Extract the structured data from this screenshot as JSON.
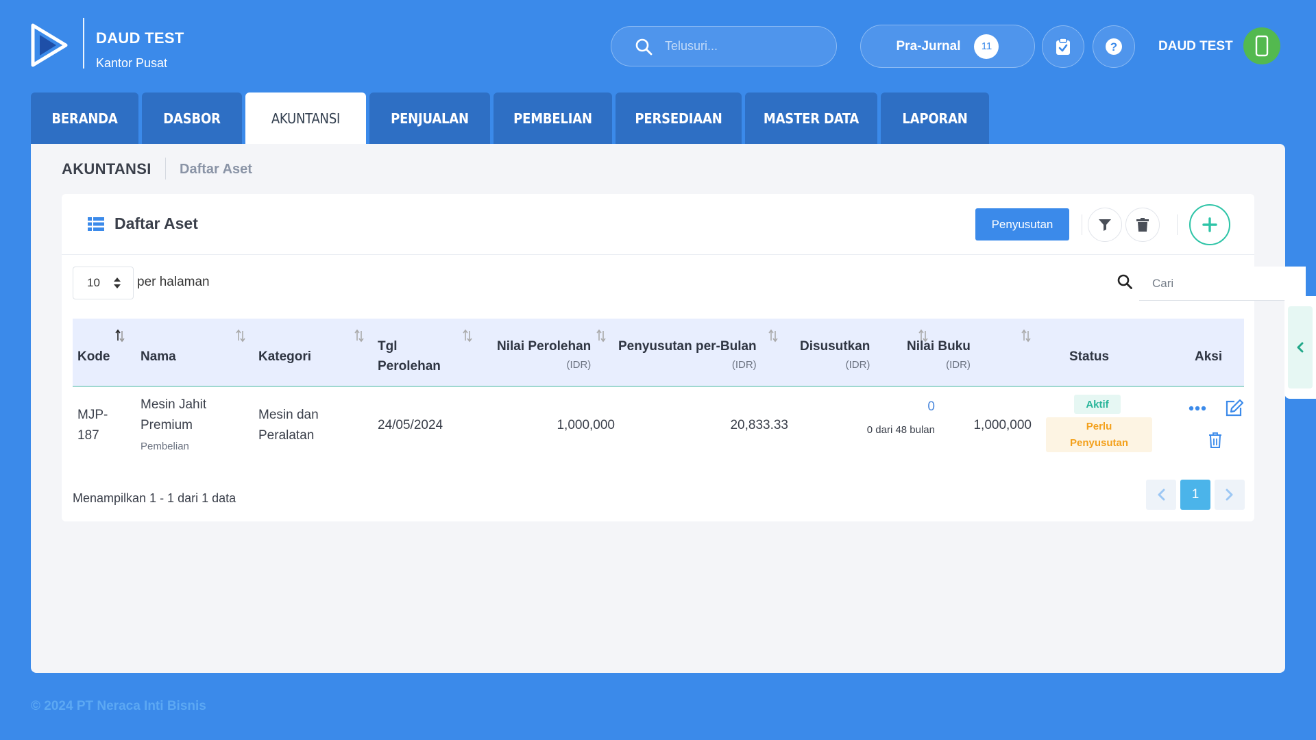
{
  "brand": {
    "name": "DAUD TEST",
    "subtitle": "Kantor Pusat"
  },
  "header": {
    "search_placeholder": "Telusuri...",
    "prajurnal_label": "Pra-Jurnal",
    "prajurnal_count": "11",
    "user_name": "DAUD TEST"
  },
  "tabs": [
    {
      "label": "BERANDA"
    },
    {
      "label": "DASBOR"
    },
    {
      "label": "AKUNTANSI"
    },
    {
      "label": "PENJUALAN"
    },
    {
      "label": "PEMBELIAN"
    },
    {
      "label": "PERSEDIAAN"
    },
    {
      "label": "MASTER DATA"
    },
    {
      "label": "LAPORAN"
    }
  ],
  "breadcrumb": {
    "section": "AKUNTANSI",
    "page": "Daftar Aset"
  },
  "card": {
    "title": "Daftar Aset",
    "penyusutan_button": "Penyusutan",
    "per_page_value": "10",
    "per_page_label": "per halaman",
    "search_placeholder": "Cari"
  },
  "table": {
    "columns": {
      "kode": "Kode",
      "nama": "Nama",
      "kategori": "Kategori",
      "tgl_line1": "Tgl",
      "tgl_line2": "Perolehan",
      "nilai_perolehan": "Nilai Perolehan",
      "nilai_perolehan_unit": "(IDR)",
      "penyusutan": "Penyusutan per-Bulan",
      "penyusutan_unit": "(IDR)",
      "disusutkan": "Disusutkan",
      "disusutkan_unit": "(IDR)",
      "nilai_buku": "Nilai Buku",
      "nilai_buku_unit": "(IDR)",
      "status": "Status",
      "aksi": "Aksi"
    },
    "rows": [
      {
        "kode_line1": "MJP-",
        "kode_line2": "187",
        "nama_line1": "Mesin Jahit",
        "nama_line2": "Premium",
        "nama_sub": "Pembelian",
        "kategori_line1": "Mesin dan",
        "kategori_line2": "Peralatan",
        "tgl": "24/05/2024",
        "nilai_perolehan": "1,000,000",
        "penyusutan": "20,833.33",
        "disusutkan": "0",
        "disusutkan_sub": "0 dari 48 bulan",
        "nilai_buku": "1,000,000",
        "status_1": "Aktif",
        "status_2_line1": "Perlu",
        "status_2_line2": "Penyusutan"
      }
    ]
  },
  "pagination": {
    "summary": "Menampilkan 1 - 1 dari 1 data",
    "current": "1"
  },
  "copyright": "© 2024 PT Neraca Inti Bisnis",
  "colors": {
    "background": "#3b8aea",
    "tab": "#2e6fc4",
    "accent_teal": "#2ec4a7",
    "warning": "#f3a01b",
    "avatar": "#53b94f"
  }
}
